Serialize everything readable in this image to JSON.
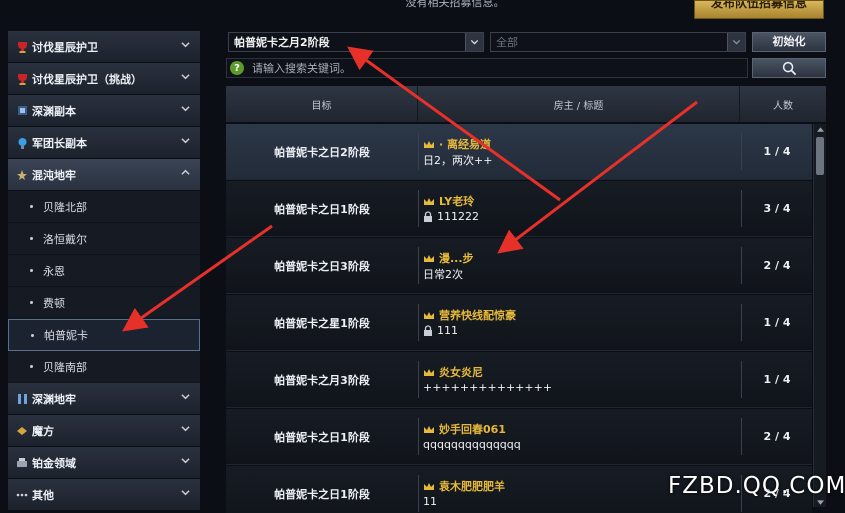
{
  "header": {
    "notice": "没有相关招募信息。",
    "publish_label": "发布队伍招募信息"
  },
  "sidebar": {
    "categories": [
      {
        "label": "讨伐星辰护卫",
        "icon": "red-trophy-icon",
        "open": false
      },
      {
        "label": "讨伐星辰护卫（挑战）",
        "icon": "red-trophy-icon",
        "open": false
      },
      {
        "label": "深渊副本",
        "icon": "abyss-icon",
        "open": false
      },
      {
        "label": "军团长副本",
        "icon": "blue-orb-icon",
        "open": false
      },
      {
        "label": "混沌地牢",
        "icon": "chaos-icon",
        "open": true
      }
    ],
    "subitems": [
      "贝隆北部",
      "洛恒戴尔",
      "永恩",
      "费顿",
      "帕普妮卡",
      "贝隆南部"
    ],
    "selected_subitem": "帕普妮卡",
    "categories_after": [
      {
        "label": "深渊地牢",
        "icon": "pillar-icon"
      },
      {
        "label": "魔方",
        "icon": "cube-icon"
      },
      {
        "label": "铂金领域",
        "icon": "platinum-icon"
      },
      {
        "label": "其他",
        "icon": "dots-icon"
      }
    ]
  },
  "filters": {
    "stage_value": "帕普妮卡之月2阶段",
    "type_value": "全部",
    "reset_label": "初始化",
    "search_placeholder": "请输入搜索关键词。",
    "help_glyph": "?"
  },
  "table": {
    "headers": {
      "target": "目标",
      "host": "房主 / 标题",
      "count": "人数"
    },
    "rows": [
      {
        "target": "帕普妮卡之日2阶段",
        "host": "· 离经易道",
        "title": "日2，两次++",
        "locked": false,
        "count": "1 / 4",
        "highlight": true
      },
      {
        "target": "帕普妮卡之日1阶段",
        "host": "LY老玲",
        "title": "111222",
        "locked": true,
        "count": "3 / 4",
        "highlight": false
      },
      {
        "target": "帕普妮卡之日3阶段",
        "host": "漫...步",
        "title": "日常2次",
        "locked": false,
        "count": "2 / 4",
        "highlight": false
      },
      {
        "target": "帕普妮卡之星1阶段",
        "host": "营养快线配惊豪",
        "title": "111",
        "locked": true,
        "count": "1 / 4",
        "highlight": false
      },
      {
        "target": "帕普妮卡之月3阶段",
        "host": "炎女炎尼",
        "title": "++++++++++++++",
        "locked": false,
        "count": "1 / 4",
        "highlight": false
      },
      {
        "target": "帕普妮卡之日1阶段",
        "host": "妙手回春061",
        "title": "qqqqqqqqqqqqqq",
        "locked": false,
        "count": "2 / 4",
        "highlight": false
      },
      {
        "target": "帕普妮卡之日1阶段",
        "host": "袁木肥肥肥羊",
        "title": "11",
        "locked": false,
        "count": "2 / 4",
        "highlight": false
      }
    ]
  },
  "watermark": "FZBD.QQ.COM",
  "colors": {
    "host_gold": "#e6b93a",
    "arrow_red": "#e8302a"
  }
}
